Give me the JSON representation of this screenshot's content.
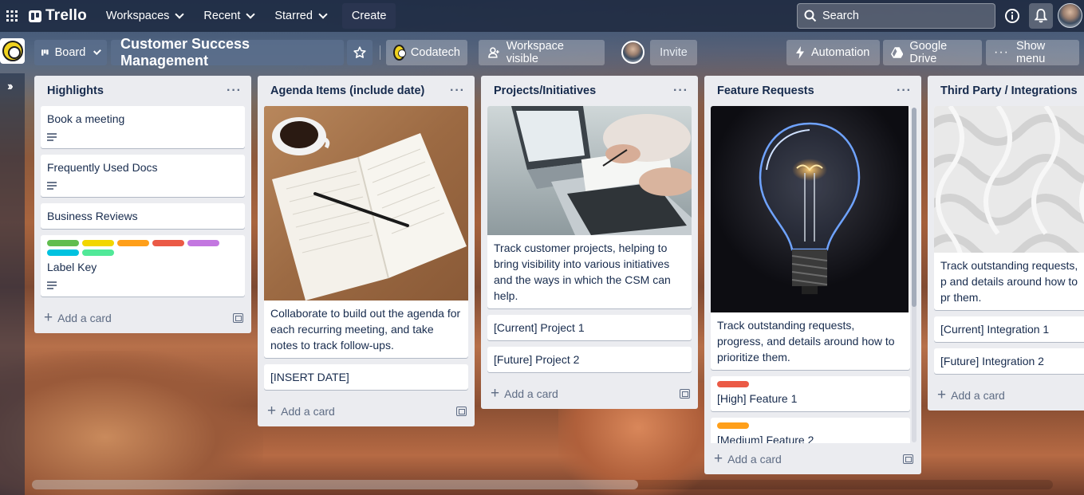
{
  "topnav": {
    "logo": "Trello",
    "workspaces": "Workspaces",
    "recent": "Recent",
    "starred": "Starred",
    "create": "Create",
    "search_placeholder": "Search"
  },
  "board": {
    "view": "Board",
    "title": "Customer Success Management",
    "workspace": "Codatech",
    "visibility": "Workspace visible",
    "invite": "Invite",
    "automation": "Automation",
    "google_drive": "Google Drive",
    "show_menu": "Show menu"
  },
  "lists": [
    {
      "title": "Highlights",
      "cards": [
        {
          "text": "Book a meeting",
          "has_description": true
        },
        {
          "text": "Frequently Used Docs",
          "has_description": true
        },
        {
          "text": "Business Reviews",
          "has_description": false
        },
        {
          "text": "Label Key",
          "has_description": true,
          "labels": [
            "#61bd4f",
            "#f2d600",
            "#ff9f1a",
            "#eb5a46",
            "#c377e0",
            "#00c2e0",
            "#51e898"
          ]
        }
      ],
      "add_card": "Add a card"
    },
    {
      "title": "Agenda Items (include date)",
      "cards": [
        {
          "cover": "notebook-photo",
          "text": "Collaborate to build out the agenda for each recurring meeting, and take notes to track follow-ups."
        },
        {
          "text": "[INSERT DATE]"
        }
      ],
      "add_card": "Add a card"
    },
    {
      "title": "Projects/Initiatives",
      "cards": [
        {
          "cover": "laptop-photo",
          "text": "Track customer projects, helping to bring visibility into various initiatives and the ways in which the CSM can help."
        },
        {
          "text": "[Current] Project 1"
        },
        {
          "text": "[Future] Project 2"
        }
      ],
      "add_card": "Add a card"
    },
    {
      "title": "Feature Requests",
      "cards": [
        {
          "cover": "lightbulb-photo",
          "text": "Track outstanding requests, progress, and details around how to prioritize them."
        },
        {
          "text": "[High] Feature 1",
          "labels": [
            "#eb5a46"
          ]
        },
        {
          "text": "[Medium] Feature 2",
          "labels": [
            "#ff9f1a"
          ]
        }
      ],
      "add_card": "Add a card"
    },
    {
      "title": "Third Party / Integrations",
      "cards": [
        {
          "cover": "white-pattern-photo",
          "text": "Track outstanding requests, p and details around how to pr them."
        },
        {
          "text": "[Current] Integration 1"
        },
        {
          "text": "[Future] Integration 2"
        }
      ],
      "add_card": "Add a card"
    }
  ]
}
